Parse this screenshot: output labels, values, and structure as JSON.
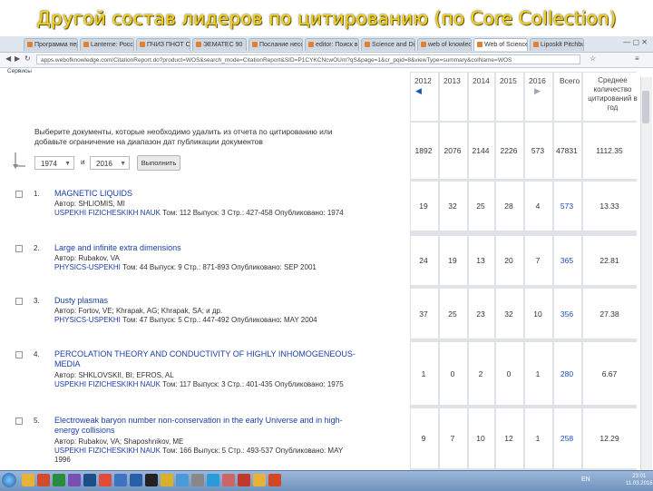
{
  "slide": {
    "title": "Другой состав лидеров по цитированию (по Core Collection)"
  },
  "browser": {
    "tabs": [
      "Программа пер",
      "Lanterne: Россия",
      "ПЧИЗ ПНОТ С/4",
      "ЭЕМАТЕС 90",
      "Послание несобщ",
      "editor: Поиск в",
      "Science and Dipa",
      "web of knowledge",
      "Web of Science ",
      "Liposklt Pitchbuck"
    ],
    "active_tab": 8,
    "address": "apps.webofknowledge.com/CitationReport.do?product=WOS&search_mode=CitationReport&SID=P1CYKCNcwOUm?qS&page=1&cr_pqid=8&viewType=summary&colName=WOS",
    "bookmarks_label": "Сервисы"
  },
  "report": {
    "years": [
      "2012",
      "2013",
      "2014",
      "2015",
      "2016"
    ],
    "total_header": "Всего",
    "avg_header": "Среднее количество цитирований в год",
    "instructions": "Выберите документы, которые необходимо удалить из отчета по цитированию или добавьте ограничение на диапазон дат публикации документов",
    "filter": {
      "from": "1974",
      "and_label": "и",
      "to": "2016",
      "apply": "Выполнить"
    },
    "totals": [
      "1892",
      "2076",
      "2144",
      "2226",
      "573",
      "47831",
      "1112.35"
    ],
    "records": [
      {
        "num": "1.",
        "title": "MAGNETIC LIQUIDS",
        "author": "Автор: SHLIOMIS, MI",
        "journal": "USPEKHI FIZICHESKIKH NAUK",
        "details": "Том: 112   Выпуск: 3   Стр.: 427-458   Опубликовано: 1974",
        "values": [
          "19",
          "32",
          "25",
          "28",
          "4"
        ],
        "total": "573",
        "avg": "13.33"
      },
      {
        "num": "2.",
        "title": "Large and infinite extra dimensions",
        "author": "Автор: Rubakov, VA",
        "journal": "PHYSICS-USPEKHI",
        "details": "Том: 44   Выпуск: 9   Стр.: 871-893   Опубликовано: SEP 2001",
        "values": [
          "24",
          "19",
          "13",
          "20",
          "7"
        ],
        "total": "365",
        "avg": "22.81"
      },
      {
        "num": "3.",
        "title": "Dusty plasmas",
        "author": "Автор: Fortov, VE; Khrapak, AG; Khrapak, SA; и др.",
        "journal": "PHYSICS-USPEKHI",
        "details": "Том: 47   Выпуск: 5   Стр.: 447-492   Опубликовано: MAY 2004",
        "values": [
          "37",
          "25",
          "23",
          "32",
          "10"
        ],
        "total": "356",
        "avg": "27.38"
      },
      {
        "num": "4.",
        "title": "PERCOLATION THEORY AND CONDUCTIVITY OF HIGHLY INHOMOGENEOUS-MEDIA",
        "author": "Автор: SHKLOVSKII, BI; EFROS, AL",
        "journal": "USPEKHI FIZICHESKIKH NAUK",
        "details": "Том: 117   Выпуск: 3   Стр.: 401-435   Опубликовано: 1975",
        "values": [
          "1",
          "0",
          "2",
          "0",
          "1"
        ],
        "total": "280",
        "avg": "6.67"
      },
      {
        "num": "5.",
        "title": "Electroweak baryon number non-conservation in the early Universe and in high-energy collisions",
        "author": "Автор: Rubakov, VA; Shaposhnikov, ME",
        "journal": "USPEKHI FIZICHESKIKH NAUK",
        "details": "Том: 166   Выпуск: 5   Стр.: 493-537   Опубликовано: MAY",
        "details2": "1996",
        "values": [
          "9",
          "7",
          "10",
          "12",
          "1"
        ],
        "total": "258",
        "avg": "12.29"
      }
    ]
  },
  "taskbar": {
    "lang": "EN",
    "clock_time": "23:01",
    "clock_date": "11.03.2016"
  },
  "colors": {
    "title": "#f3d21c",
    "link": "#1a3ea8",
    "total": "#1a4cb8",
    "grid": "#dfe3e7"
  }
}
